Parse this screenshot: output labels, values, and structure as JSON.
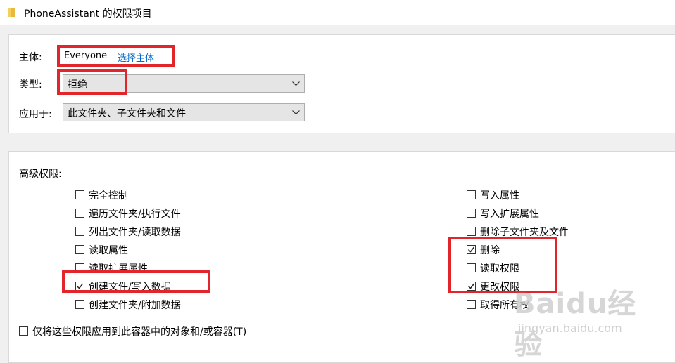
{
  "window": {
    "title": "PhoneAssistant 的权限项目"
  },
  "principal": {
    "label": "主体:",
    "value": "Everyone",
    "select_link": "选择主体"
  },
  "type": {
    "label": "类型:",
    "value": "拒绝"
  },
  "applies_to": {
    "label": "应用于:",
    "value": "此文件夹、子文件夹和文件"
  },
  "advanced": {
    "heading": "高级权限:",
    "left": [
      {
        "label": "完全控制",
        "checked": false
      },
      {
        "label": "遍历文件夹/执行文件",
        "checked": false
      },
      {
        "label": "列出文件夹/读取数据",
        "checked": false
      },
      {
        "label": "读取属性",
        "checked": false
      },
      {
        "label": "读取扩展属性",
        "checked": false
      },
      {
        "label": "创建文件/写入数据",
        "checked": true
      },
      {
        "label": "创建文件夹/附加数据",
        "checked": false
      }
    ],
    "right": [
      {
        "label": "写入属性",
        "checked": false
      },
      {
        "label": "写入扩展属性",
        "checked": false
      },
      {
        "label": "删除子文件夹及文件",
        "checked": false
      },
      {
        "label": "删除",
        "checked": true
      },
      {
        "label": "读取权限",
        "checked": false
      },
      {
        "label": "更改权限",
        "checked": true
      },
      {
        "label": "取得所有权",
        "checked": false
      }
    ]
  },
  "apply_only": {
    "label": "仅将这些权限应用到此容器中的对象和/或容器(T)",
    "checked": false
  },
  "watermark": {
    "brand": "Baidu经验",
    "url": "jingyan.baidu.com"
  },
  "colors": {
    "highlight": "#e0262b",
    "link": "#0066cc"
  }
}
